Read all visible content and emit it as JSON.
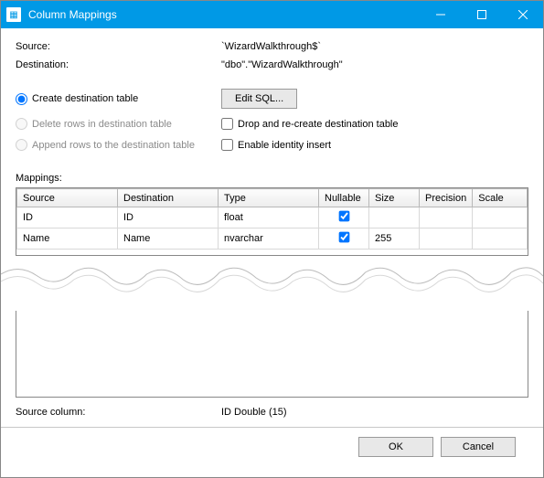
{
  "title": "Column Mappings",
  "source_label": "Source:",
  "source_value": "`WizardWalkthrough$`",
  "dest_label": "Destination:",
  "dest_value": "\"dbo\".\"WizardWalkthrough\"",
  "opt_create": "Create destination table",
  "opt_delete": "Delete rows in destination table",
  "opt_append": "Append rows to the destination table",
  "btn_edit_sql": "Edit SQL...",
  "chk_drop": "Drop and re-create destination table",
  "chk_identity": "Enable identity insert",
  "mappings_label": "Mappings:",
  "cols": {
    "source": "Source",
    "destination": "Destination",
    "type": "Type",
    "nullable": "Nullable",
    "size": "Size",
    "precision": "Precision",
    "scale": "Scale"
  },
  "rows": [
    {
      "source": "ID",
      "destination": "ID",
      "type": "float",
      "nullable": true,
      "size": "",
      "precision": "",
      "scale": ""
    },
    {
      "source": "Name",
      "destination": "Name",
      "type": "nvarchar",
      "nullable": true,
      "size": "255",
      "precision": "",
      "scale": ""
    }
  ],
  "src_col_label": "Source column:",
  "src_col_value": "ID Double (15)",
  "btn_ok": "OK",
  "btn_cancel": "Cancel"
}
